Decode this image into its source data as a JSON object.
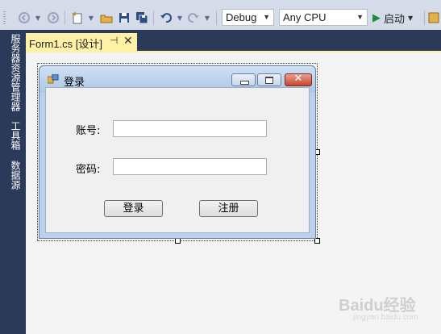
{
  "toolbar": {
    "config_value": "Debug",
    "platform_value": "Any CPU",
    "start_label": "启动",
    "icons": [
      "back-icon",
      "forward-icon",
      "new-project-icon",
      "open-folder-icon",
      "save-icon",
      "save-all-icon",
      "undo-icon",
      "redo-icon",
      "start-icon",
      "attach-icon"
    ]
  },
  "left_panel": {
    "tabs": [
      "服务器资源管理器",
      "工具箱",
      "数据源"
    ]
  },
  "document": {
    "tab_label": "Form1.cs [设计]"
  },
  "form": {
    "title": "登录",
    "account_label": "账号:",
    "password_label": "密码:",
    "account_value": "",
    "password_value": "",
    "login_button": "登录",
    "register_button": "注册"
  },
  "watermark": {
    "text": "Baidu经验",
    "sub": "jingyan.baidu.com"
  },
  "colors": {
    "toolbar_bg": "#d6dbe9",
    "side_panel": "#2c3a5a",
    "active_tab": "#fff1a6",
    "form_frame": "#b9d1ea"
  }
}
